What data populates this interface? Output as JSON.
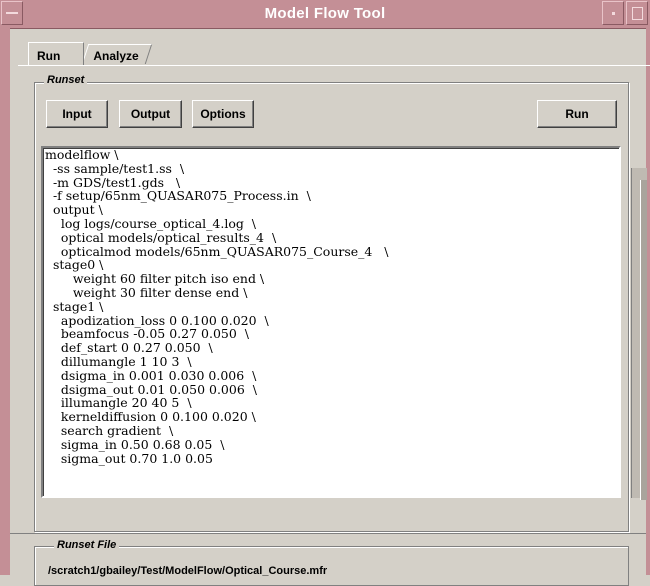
{
  "window": {
    "title": "Model Flow Tool"
  },
  "tabs": [
    {
      "label": "Run",
      "active": true
    },
    {
      "label": "Analyze",
      "active": false
    }
  ],
  "runset": {
    "group_label": "Runset",
    "buttons": {
      "input": "Input",
      "output": "Output",
      "options": "Options",
      "run": "Run"
    },
    "script": "modelflow \\\n  -ss sample/test1.ss  \\\n  -m GDS/test1.gds   \\\n  -f setup/65nm_QUASAR075_Process.in  \\\n  output \\\n    log logs/course_optical_4.log  \\\n    optical models/optical_results_4  \\\n    opticalmod models/65nm_QUASAR075_Course_4   \\\n  stage0 \\\n       weight 60 filter pitch iso end \\\n       weight 30 filter dense end \\\n  stage1 \\\n    apodization_loss 0 0.100 0.020  \\\n    beamfocus -0.05 0.27 0.050  \\\n    def_start 0 0.27 0.050  \\\n    dillumangle 1 10 3  \\\n    dsigma_in 0.001 0.030 0.006  \\\n    dsigma_out 0.01 0.050 0.006  \\\n    illumangle 20 40 5  \\\n    kerneldiffusion 0 0.100 0.020 \\\n    search gradient  \\\n    sigma_in 0.50 0.68 0.05  \\\n    sigma_out 0.70 1.0 0.05"
  },
  "runset_file": {
    "group_label": "Runset File",
    "path": "/scratch1/gbailey/Test/ModelFlow/Optical_Course.mfr"
  },
  "colors": {
    "titlebar": "#c48f96",
    "window_bg": "#d4d0c8",
    "text_bg": "#ffffff"
  }
}
